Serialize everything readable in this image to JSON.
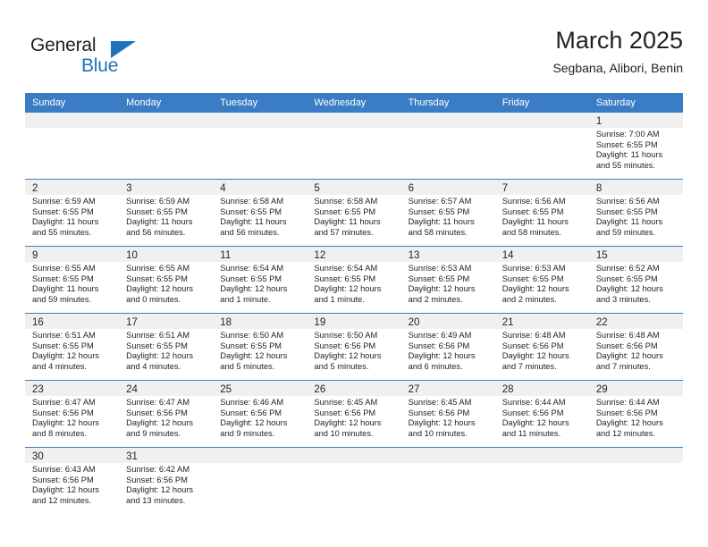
{
  "logo": {
    "word_one": "General",
    "word_two": "Blue",
    "triangle_color": "#1f72bb",
    "text_color": "#231f20"
  },
  "header": {
    "title": "March 2025",
    "subtitle": "Segbana, Alibori, Benin"
  },
  "theme": {
    "header_blue": "#3b7dc4",
    "row_divider": "#3b7dc4",
    "datebar_gray": "#f0f0f0",
    "text": "#231f20"
  },
  "weekdays": [
    "Sunday",
    "Monday",
    "Tuesday",
    "Wednesday",
    "Thursday",
    "Friday",
    "Saturday"
  ],
  "labels": {
    "sunrise": "Sunrise:",
    "sunset": "Sunset:",
    "daylight": "Daylight:"
  },
  "weeks": [
    [
      {
        "day": "",
        "empty": true
      },
      {
        "day": "",
        "empty": true
      },
      {
        "day": "",
        "empty": true
      },
      {
        "day": "",
        "empty": true
      },
      {
        "day": "",
        "empty": true
      },
      {
        "day": "",
        "empty": true
      },
      {
        "day": "1",
        "sunrise": "Sunrise: 7:00 AM",
        "sunset": "Sunset: 6:55 PM",
        "daylight": "Daylight: 11 hours and 55 minutes."
      }
    ],
    [
      {
        "day": "2",
        "sunrise": "Sunrise: 6:59 AM",
        "sunset": "Sunset: 6:55 PM",
        "daylight": "Daylight: 11 hours and 55 minutes."
      },
      {
        "day": "3",
        "sunrise": "Sunrise: 6:59 AM",
        "sunset": "Sunset: 6:55 PM",
        "daylight": "Daylight: 11 hours and 56 minutes."
      },
      {
        "day": "4",
        "sunrise": "Sunrise: 6:58 AM",
        "sunset": "Sunset: 6:55 PM",
        "daylight": "Daylight: 11 hours and 56 minutes."
      },
      {
        "day": "5",
        "sunrise": "Sunrise: 6:58 AM",
        "sunset": "Sunset: 6:55 PM",
        "daylight": "Daylight: 11 hours and 57 minutes."
      },
      {
        "day": "6",
        "sunrise": "Sunrise: 6:57 AM",
        "sunset": "Sunset: 6:55 PM",
        "daylight": "Daylight: 11 hours and 58 minutes."
      },
      {
        "day": "7",
        "sunrise": "Sunrise: 6:56 AM",
        "sunset": "Sunset: 6:55 PM",
        "daylight": "Daylight: 11 hours and 58 minutes."
      },
      {
        "day": "8",
        "sunrise": "Sunrise: 6:56 AM",
        "sunset": "Sunset: 6:55 PM",
        "daylight": "Daylight: 11 hours and 59 minutes."
      }
    ],
    [
      {
        "day": "9",
        "sunrise": "Sunrise: 6:55 AM",
        "sunset": "Sunset: 6:55 PM",
        "daylight": "Daylight: 11 hours and 59 minutes."
      },
      {
        "day": "10",
        "sunrise": "Sunrise: 6:55 AM",
        "sunset": "Sunset: 6:55 PM",
        "daylight": "Daylight: 12 hours and 0 minutes."
      },
      {
        "day": "11",
        "sunrise": "Sunrise: 6:54 AM",
        "sunset": "Sunset: 6:55 PM",
        "daylight": "Daylight: 12 hours and 1 minute."
      },
      {
        "day": "12",
        "sunrise": "Sunrise: 6:54 AM",
        "sunset": "Sunset: 6:55 PM",
        "daylight": "Daylight: 12 hours and 1 minute."
      },
      {
        "day": "13",
        "sunrise": "Sunrise: 6:53 AM",
        "sunset": "Sunset: 6:55 PM",
        "daylight": "Daylight: 12 hours and 2 minutes."
      },
      {
        "day": "14",
        "sunrise": "Sunrise: 6:53 AM",
        "sunset": "Sunset: 6:55 PM",
        "daylight": "Daylight: 12 hours and 2 minutes."
      },
      {
        "day": "15",
        "sunrise": "Sunrise: 6:52 AM",
        "sunset": "Sunset: 6:55 PM",
        "daylight": "Daylight: 12 hours and 3 minutes."
      }
    ],
    [
      {
        "day": "16",
        "sunrise": "Sunrise: 6:51 AM",
        "sunset": "Sunset: 6:55 PM",
        "daylight": "Daylight: 12 hours and 4 minutes."
      },
      {
        "day": "17",
        "sunrise": "Sunrise: 6:51 AM",
        "sunset": "Sunset: 6:55 PM",
        "daylight": "Daylight: 12 hours and 4 minutes."
      },
      {
        "day": "18",
        "sunrise": "Sunrise: 6:50 AM",
        "sunset": "Sunset: 6:55 PM",
        "daylight": "Daylight: 12 hours and 5 minutes."
      },
      {
        "day": "19",
        "sunrise": "Sunrise: 6:50 AM",
        "sunset": "Sunset: 6:56 PM",
        "daylight": "Daylight: 12 hours and 5 minutes."
      },
      {
        "day": "20",
        "sunrise": "Sunrise: 6:49 AM",
        "sunset": "Sunset: 6:56 PM",
        "daylight": "Daylight: 12 hours and 6 minutes."
      },
      {
        "day": "21",
        "sunrise": "Sunrise: 6:48 AM",
        "sunset": "Sunset: 6:56 PM",
        "daylight": "Daylight: 12 hours and 7 minutes."
      },
      {
        "day": "22",
        "sunrise": "Sunrise: 6:48 AM",
        "sunset": "Sunset: 6:56 PM",
        "daylight": "Daylight: 12 hours and 7 minutes."
      }
    ],
    [
      {
        "day": "23",
        "sunrise": "Sunrise: 6:47 AM",
        "sunset": "Sunset: 6:56 PM",
        "daylight": "Daylight: 12 hours and 8 minutes."
      },
      {
        "day": "24",
        "sunrise": "Sunrise: 6:47 AM",
        "sunset": "Sunset: 6:56 PM",
        "daylight": "Daylight: 12 hours and 9 minutes."
      },
      {
        "day": "25",
        "sunrise": "Sunrise: 6:46 AM",
        "sunset": "Sunset: 6:56 PM",
        "daylight": "Daylight: 12 hours and 9 minutes."
      },
      {
        "day": "26",
        "sunrise": "Sunrise: 6:45 AM",
        "sunset": "Sunset: 6:56 PM",
        "daylight": "Daylight: 12 hours and 10 minutes."
      },
      {
        "day": "27",
        "sunrise": "Sunrise: 6:45 AM",
        "sunset": "Sunset: 6:56 PM",
        "daylight": "Daylight: 12 hours and 10 minutes."
      },
      {
        "day": "28",
        "sunrise": "Sunrise: 6:44 AM",
        "sunset": "Sunset: 6:56 PM",
        "daylight": "Daylight: 12 hours and 11 minutes."
      },
      {
        "day": "29",
        "sunrise": "Sunrise: 6:44 AM",
        "sunset": "Sunset: 6:56 PM",
        "daylight": "Daylight: 12 hours and 12 minutes."
      }
    ],
    [
      {
        "day": "30",
        "sunrise": "Sunrise: 6:43 AM",
        "sunset": "Sunset: 6:56 PM",
        "daylight": "Daylight: 12 hours and 12 minutes."
      },
      {
        "day": "31",
        "sunrise": "Sunrise: 6:42 AM",
        "sunset": "Sunset: 6:56 PM",
        "daylight": "Daylight: 12 hours and 13 minutes."
      },
      {
        "day": "",
        "empty": true
      },
      {
        "day": "",
        "empty": true
      },
      {
        "day": "",
        "empty": true
      },
      {
        "day": "",
        "empty": true
      },
      {
        "day": "",
        "empty": true
      }
    ]
  ]
}
